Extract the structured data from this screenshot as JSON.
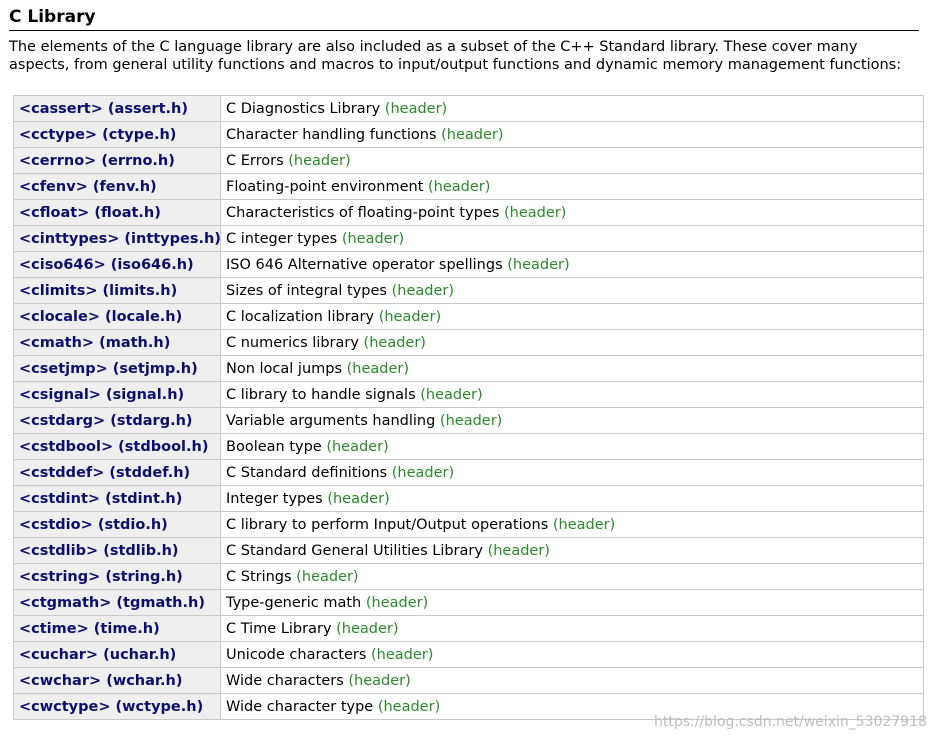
{
  "section": {
    "title": "C Library",
    "intro": "The elements of the C language library are also included as a subset of the C++ Standard library. These cover many aspects, from general utility functions and macros to input/output functions and dynamic memory management functions:"
  },
  "libraries": [
    {
      "name": "<cassert> (assert.h)",
      "description": "C Diagnostics Library",
      "tag": "(header)"
    },
    {
      "name": "<cctype> (ctype.h)",
      "description": "Character handling functions",
      "tag": "(header)"
    },
    {
      "name": "<cerrno> (errno.h)",
      "description": "C Errors",
      "tag": "(header)"
    },
    {
      "name": "<cfenv> (fenv.h)",
      "description": "Floating-point environment",
      "tag": "(header)"
    },
    {
      "name": "<cfloat> (float.h)",
      "description": "Characteristics of floating-point types",
      "tag": "(header)"
    },
    {
      "name": "<cinttypes> (inttypes.h)",
      "description": "C integer types",
      "tag": "(header)"
    },
    {
      "name": "<ciso646> (iso646.h)",
      "description": "ISO 646 Alternative operator spellings",
      "tag": "(header)"
    },
    {
      "name": "<climits> (limits.h)",
      "description": "Sizes of integral types",
      "tag": "(header)"
    },
    {
      "name": "<clocale> (locale.h)",
      "description": "C localization library",
      "tag": "(header)"
    },
    {
      "name": "<cmath> (math.h)",
      "description": "C numerics library",
      "tag": "(header)"
    },
    {
      "name": "<csetjmp> (setjmp.h)",
      "description": "Non local jumps",
      "tag": "(header)"
    },
    {
      "name": "<csignal> (signal.h)",
      "description": "C library to handle signals",
      "tag": "(header)"
    },
    {
      "name": "<cstdarg> (stdarg.h)",
      "description": "Variable arguments handling",
      "tag": "(header)"
    },
    {
      "name": "<cstdbool> (stdbool.h)",
      "description": "Boolean type",
      "tag": "(header)"
    },
    {
      "name": "<cstddef> (stddef.h)",
      "description": "C Standard definitions",
      "tag": "(header)"
    },
    {
      "name": "<cstdint> (stdint.h)",
      "description": "Integer types",
      "tag": "(header)"
    },
    {
      "name": "<cstdio> (stdio.h)",
      "description": "C library to perform Input/Output operations",
      "tag": "(header)"
    },
    {
      "name": "<cstdlib> (stdlib.h)",
      "description": "C Standard General Utilities Library",
      "tag": "(header)"
    },
    {
      "name": "<cstring> (string.h)",
      "description": "C Strings",
      "tag": "(header)"
    },
    {
      "name": "<ctgmath> (tgmath.h)",
      "description": "Type-generic math",
      "tag": "(header)"
    },
    {
      "name": "<ctime> (time.h)",
      "description": "C Time Library",
      "tag": "(header)"
    },
    {
      "name": "<cuchar> (uchar.h)",
      "description": "Unicode characters",
      "tag": "(header)"
    },
    {
      "name": "<cwchar> (wchar.h)",
      "description": "Wide characters",
      "tag": "(header)"
    },
    {
      "name": "<cwctype> (wctype.h)",
      "description": "Wide character type",
      "tag": "(header)"
    }
  ],
  "watermark": "https://blog.csdn.net/weixin_53027918",
  "colors": {
    "link_name": "#0d0d6e",
    "header_tag": "#2b8a2b",
    "name_cell_bg": "#efefef",
    "border": "#c9c9c9"
  }
}
